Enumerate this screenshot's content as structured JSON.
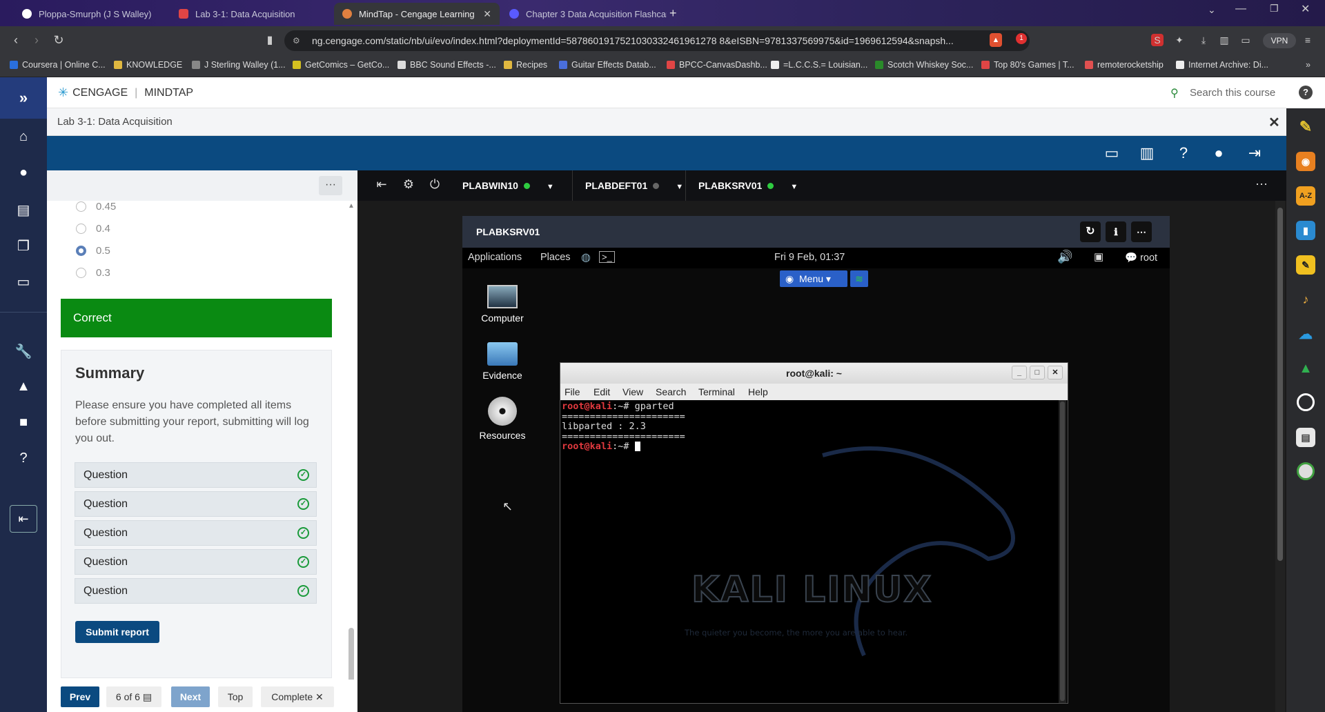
{
  "browser": {
    "tabs": [
      {
        "label": "Ploppa-Smurph (J S Walley)",
        "icon_color": "#ffffff"
      },
      {
        "label": "Lab 3-1: Data Acquisition",
        "icon_color": "#e04545"
      },
      {
        "label": "MindTap - Cengage Learning",
        "icon_color": "#e08040"
      },
      {
        "label": "Chapter 3 Data Acquisition Flashcar",
        "icon_color": "#5a5aff"
      }
    ],
    "new_tab": "+",
    "url": "ng.cengage.com/static/nb/ui/evo/index.html?deploymentId=5878601917521030332461961278 8&eISBN=9781337569975&id=1969612594&snapsh...",
    "vpn_label": "VPN",
    "brave_badge": "1",
    "bookmarks": [
      "Coursera | Online C...",
      "KNOWLEDGE",
      "J Sterling Walley (1...",
      "GetComics – GetCo...",
      "BBC Sound Effects -...",
      "Recipes",
      "Guitar Effects Datab...",
      "BPCC-CanvasDashb...",
      "=L.C.C.S.= Louisian...",
      "Scotch Whiskey Soc...",
      "Top 80's Games | T...",
      "remoterocketship",
      "Internet Archive: Di..."
    ]
  },
  "mindtap": {
    "logo_cengage": "CENGAGE",
    "logo_mindtap": "MINDTAP",
    "search_placeholder": "Search this course",
    "help": "?",
    "lab_title": "Lab 3-1: Data Acquisition",
    "close": "✕"
  },
  "leftpanel": {
    "more": "···",
    "options": [
      "0.45",
      "0.4",
      "0.5",
      "0.3"
    ],
    "selected_option": "0.5",
    "result": "Correct",
    "summary_title": "Summary",
    "summary_text": "Please ensure you have completed all items before submitting your report, submitting will log you out.",
    "questions": [
      "Question",
      "Question",
      "Question",
      "Question",
      "Question"
    ],
    "submit": "Submit report",
    "nav": {
      "prev": "Prev",
      "page": "6 of 6",
      "next": "Next",
      "top": "Top",
      "complete": "Complete"
    }
  },
  "vm": {
    "machines": [
      {
        "name": "PLABWIN10",
        "status_color": "#2ecc40"
      },
      {
        "name": "PLABDEFT01",
        "status_color": "#666666"
      },
      {
        "name": "PLABKSRV01",
        "status_color": "#2ecc40"
      }
    ],
    "window_title": "PLABKSRV01",
    "kali": {
      "applications": "Applications",
      "places": "Places",
      "clock": "Fri  9 Feb, 01:37",
      "user": "root",
      "menu": "Menu",
      "desktop_icons": [
        "Computer",
        "Evidence",
        "Resources"
      ],
      "brand": "KALI LINUX",
      "tagline": "The quieter you become, the more you are able to hear."
    },
    "terminal": {
      "title": "root@kali: ~",
      "menu": [
        "File",
        "Edit",
        "View",
        "Search",
        "Terminal",
        "Help"
      ],
      "prompt": "root@kali",
      "prompt_suffix": ":~#",
      "command": " gparted",
      "separator": "======================",
      "output": "libparted : 2.3"
    }
  }
}
